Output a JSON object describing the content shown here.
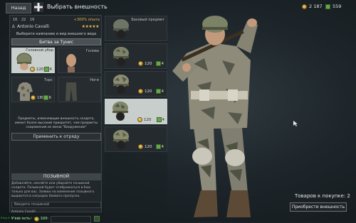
{
  "topbar": {
    "back_label": "Назад",
    "title": "Выбрать внешность",
    "silver_amount": "2 187",
    "gold_amount": "559"
  },
  "left_panel": {
    "player": {
      "stat1": "16",
      "stat2": "22",
      "stat3": "16",
      "xp_bonus": "+300% опыта",
      "name": "Antonio Cavalli",
      "stars": "★★★★★"
    },
    "campaign_hint": "Выберите кампанию и вид внешнего вида",
    "campaign_tab": "Битва за Тунис",
    "slots": [
      {
        "label": "Головной убор",
        "price": "120",
        "count": "4"
      },
      {
        "label": "Голова",
        "price": "",
        "count": ""
      },
      {
        "label": "Торс",
        "price": "180",
        "count": "6"
      },
      {
        "label": "Ноги",
        "price": "",
        "count": ""
      }
    ],
    "warning": "Предметы, изменяющие внешность солдата, имеют более высокий приоритет, чем предметы снаряжения из меню \"Вооружение\"",
    "apply_label": "Применить к отряду",
    "callsign": {
      "header": "ПОЗЫВНОЙ",
      "description": "Добавляйте, меняйте или убирайте позывной солдата. Позывной будет отображаться в бою только для вас. Заявки на изменение позывного выдаются в наградах боевого пропуска.",
      "placeholder": "Введите позывной",
      "owner": "Antonio Cavalli",
      "wallet_label": "У вас есть",
      "wallet_amount": "120"
    }
  },
  "items": [
    {
      "tag": "Базовый предмет",
      "price": "",
      "count": ""
    },
    {
      "tag": "",
      "price": "120",
      "count": "4"
    },
    {
      "tag": "",
      "price": "120",
      "count": "4"
    },
    {
      "tag": "",
      "price": "120",
      "count": "4"
    },
    {
      "tag": "",
      "price": "120",
      "count": "4"
    }
  ],
  "cart": {
    "summary": "Товаров к покупке: 2",
    "buy_label": "Приобрести внешность"
  },
  "debug": "Ping:0 FPS:38.8 (8)-5 1.5 (2k:7)"
}
